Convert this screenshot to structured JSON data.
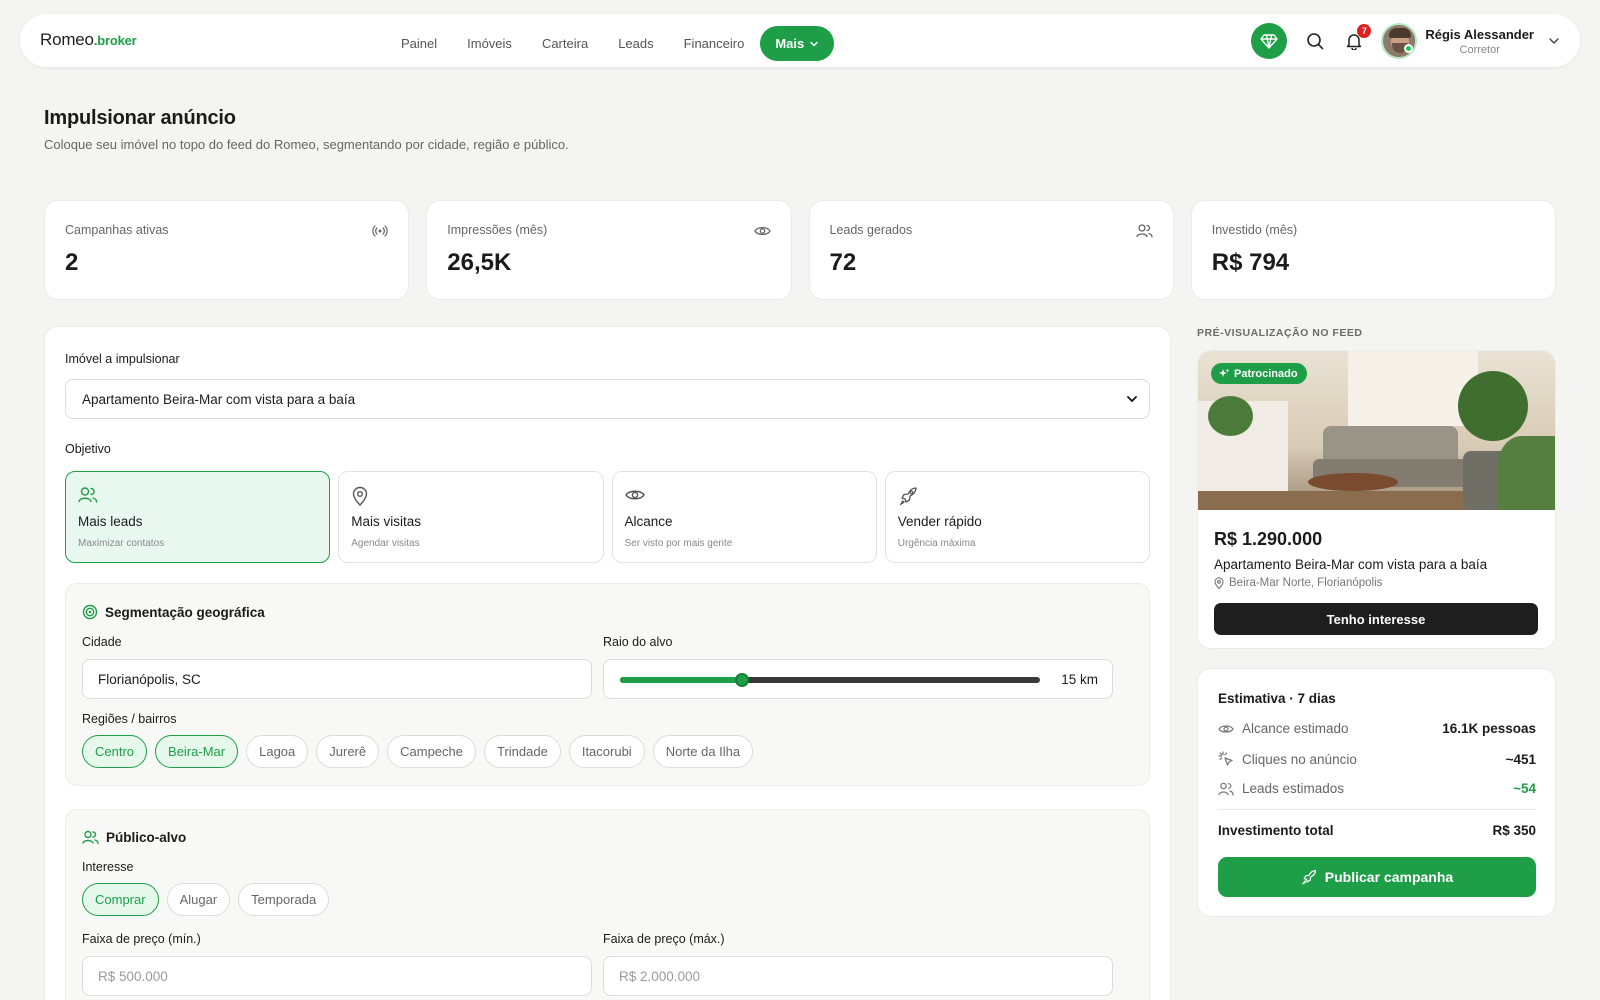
{
  "brand": {
    "name": "Romeo",
    "suffix": ".broker",
    "accent": "#1e9e47"
  },
  "nav": {
    "items": [
      "Painel",
      "Imóveis",
      "Carteira",
      "Leads",
      "Financeiro"
    ],
    "more_label": "Mais"
  },
  "user": {
    "name": "Régis Alessander",
    "role": "Corretor",
    "notifications": "7"
  },
  "page": {
    "title": "Impulsionar anúncio",
    "subtitle": "Coloque seu imóvel no topo do feed do Romeo, segmentando por cidade, região e público."
  },
  "stats": [
    {
      "label": "Campanhas ativas",
      "value": "2",
      "icon": "broadcast-icon"
    },
    {
      "label": "Impressões (mês)",
      "value": "26,5K",
      "icon": "eye-icon"
    },
    {
      "label": "Leads gerados",
      "value": "72",
      "icon": "users-icon"
    },
    {
      "label": "Investido (mês)",
      "value": "R$ 794",
      "icon": ""
    }
  ],
  "form": {
    "property_label": "Imóvel a impulsionar",
    "property_value": "Apartamento Beira-Mar com vista para a baía",
    "objective_label": "Objetivo",
    "objectives": [
      {
        "title": "Mais leads",
        "sub": "Maximizar contatos",
        "icon": "users-icon",
        "active": true
      },
      {
        "title": "Mais visitas",
        "sub": "Agendar visitas",
        "icon": "map-pin-icon",
        "active": false
      },
      {
        "title": "Alcance",
        "sub": "Ser visto por mais gente",
        "icon": "eye-icon",
        "active": false
      },
      {
        "title": "Vender rápido",
        "sub": "Urgência máxima",
        "icon": "rocket-icon",
        "active": false
      }
    ],
    "geo": {
      "title": "Segmentação geográfica",
      "city_label": "Cidade",
      "city_value": "Florianópolis, SC",
      "radius_label": "Raio do alvo",
      "radius_value": "15 km",
      "radius_fraction": 0.29,
      "regions_label": "Regiões / bairros",
      "regions": [
        {
          "label": "Centro",
          "active": true
        },
        {
          "label": "Beira-Mar",
          "active": true
        },
        {
          "label": "Lagoa",
          "active": false
        },
        {
          "label": "Jurerê",
          "active": false
        },
        {
          "label": "Campeche",
          "active": false
        },
        {
          "label": "Trindade",
          "active": false
        },
        {
          "label": "Itacorubi",
          "active": false
        },
        {
          "label": "Norte da Ilha",
          "active": false
        }
      ]
    },
    "audience": {
      "title": "Público-alvo",
      "interest_label": "Interesse",
      "interests": [
        {
          "label": "Comprar",
          "active": true
        },
        {
          "label": "Alugar",
          "active": false
        },
        {
          "label": "Temporada",
          "active": false
        }
      ],
      "price_min_label": "Faixa de preço (mín.)",
      "price_min_placeholder": "R$ 500.000",
      "price_max_label": "Faixa de preço (máx.)",
      "price_max_placeholder": "R$ 2.000.000"
    }
  },
  "preview": {
    "section_label": "PRÉ-VISUALIZAÇÃO NO FEED",
    "badge": "Patrocinado",
    "price": "R$ 1.290.000",
    "title": "Apartamento Beira-Mar com vista para a baía",
    "location": "Beira-Mar Norte, Florianópolis",
    "cta": "Tenho interesse"
  },
  "estimate": {
    "title": "Estimativa · 7 dias",
    "rows": [
      {
        "label": "Alcance estimado",
        "value": "16.1K pessoas",
        "icon": "eye-icon"
      },
      {
        "label": "Cliques no anúncio",
        "value": "~451",
        "icon": "click-icon"
      },
      {
        "label": "Leads estimados",
        "value": "~54",
        "icon": "users-icon"
      }
    ],
    "total_label": "Investimento total",
    "total_value": "R$ 350",
    "publish_label": "Publicar campanha"
  }
}
